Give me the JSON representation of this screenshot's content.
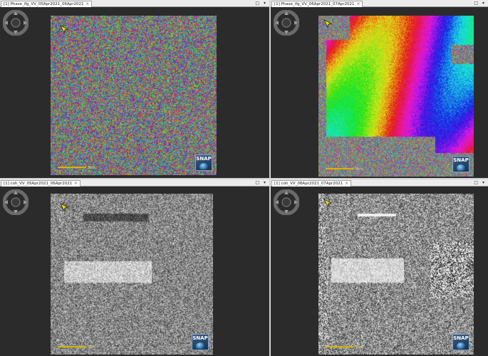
{
  "panes": [
    {
      "id": "tl",
      "tab_label": "[1] Phase_ifg_VV_05Apr2021_06Apr2021",
      "active": true,
      "render": "phase-noise",
      "scale_label": "8km"
    },
    {
      "id": "tr",
      "tab_label": "[1] Phase_ifg_VV_06Apr2021_07Apr2021",
      "active": false,
      "render": "phase-fringes",
      "scale_label": "8km"
    },
    {
      "id": "bl",
      "tab_label": "[1] coh_VV_05Apr2021_06Apr2021",
      "active": false,
      "render": "coh-low",
      "scale_label": "8km"
    },
    {
      "id": "br",
      "tab_label": "[1] coh_VV_06Apr2021_07Apr2021",
      "active": false,
      "render": "coh-high",
      "scale_label": "8km"
    }
  ],
  "window_controls": "□ ▾",
  "logo_text": "SNAP",
  "colors": {
    "active_border": "#c9a84a",
    "viewer_bg": "#2b2b2b",
    "scalebar": "#d4b400",
    "arrow": "#f5e400"
  }
}
